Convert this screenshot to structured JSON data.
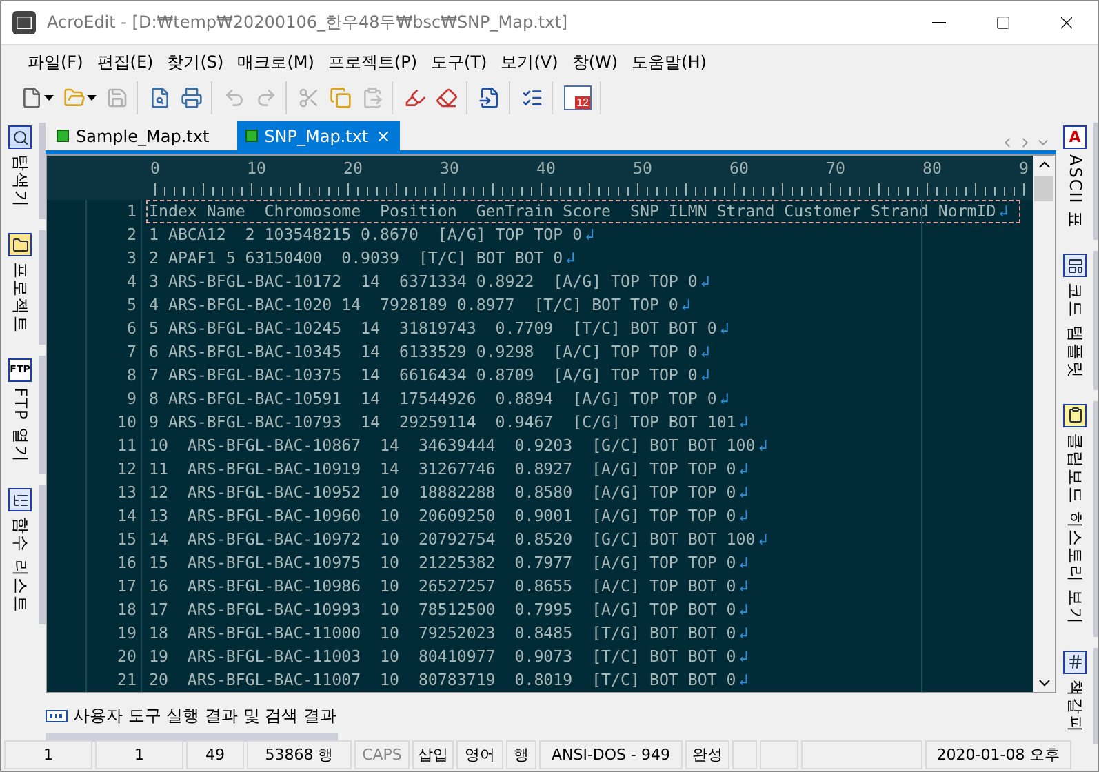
{
  "window": {
    "title": "AcroEdit - [D:₩temp₩20200106_한우48두₩bsc₩SNP_Map.txt]"
  },
  "menu": [
    "파일(F)",
    "편집(E)",
    "찾기(S)",
    "매크로(M)",
    "프로젝트(P)",
    "도구(T)",
    "보기(V)",
    "창(W)",
    "도움말(H)"
  ],
  "toolbar": [
    {
      "kind": "new",
      "disabled": false,
      "dropdown": true
    },
    {
      "kind": "open",
      "disabled": false,
      "dropdown": true
    },
    {
      "kind": "save",
      "disabled": true,
      "dropdown": false
    },
    {
      "kind": "preview",
      "disabled": false,
      "dropdown": false
    },
    {
      "kind": "print",
      "disabled": false,
      "dropdown": false
    },
    {
      "kind": "undo",
      "disabled": true,
      "dropdown": false
    },
    {
      "kind": "redo",
      "disabled": true,
      "dropdown": false
    },
    {
      "kind": "cut",
      "disabled": true,
      "dropdown": false
    },
    {
      "kind": "copy",
      "disabled": false,
      "dropdown": false
    },
    {
      "kind": "paste",
      "disabled": true,
      "dropdown": false
    },
    {
      "kind": "highlight",
      "disabled": false,
      "dropdown": false
    },
    {
      "kind": "erase",
      "disabled": false,
      "dropdown": false
    },
    {
      "kind": "insert",
      "disabled": false,
      "dropdown": false
    },
    {
      "kind": "list",
      "disabled": false,
      "dropdown": false
    },
    {
      "kind": "calendar",
      "disabled": false,
      "dropdown": false,
      "label": "12"
    }
  ],
  "left_dock": [
    {
      "kind": "search",
      "label": "탐색기"
    },
    {
      "kind": "folder",
      "label": "프로젝트"
    },
    {
      "kind": "ftp",
      "label": "FTP 열기",
      "icon_label": "FTP"
    },
    {
      "kind": "functions",
      "label": "함수 리스트"
    }
  ],
  "right_dock": [
    {
      "kind": "ascii",
      "label": "ASCII 표",
      "icon_label": "A"
    },
    {
      "kind": "template",
      "label": "코드 템플릿"
    },
    {
      "kind": "clipboard",
      "label": "클립보드 히스토리 보기"
    },
    {
      "kind": "bookmark",
      "label": "책갈피"
    }
  ],
  "tabs": [
    {
      "label": "Sample_Map.txt",
      "selected": false
    },
    {
      "label": "SNP_Map.txt",
      "selected": true
    }
  ],
  "ruler": [
    "0",
    "10",
    "20",
    "30",
    "40",
    "50",
    "60",
    "70",
    "80",
    "9"
  ],
  "lines": [
    {
      "number": "1",
      "text": "Index Name  Chromosome  Position  GenTrain Score  SNP ILMN Strand Customer Strand NormID",
      "eol": "↲",
      "current": true
    },
    {
      "number": "2",
      "text": "1 ABCA12  2 103548215 0.8670  [A/G] TOP TOP 0",
      "eol": "↲",
      "current": false
    },
    {
      "number": "3",
      "text": "2 APAF1 5 63150400  0.9039  [T/C] BOT BOT 0",
      "eol": "↲",
      "current": false
    },
    {
      "number": "4",
      "text": "3 ARS-BFGL-BAC-10172  14  6371334 0.8922  [A/G] TOP TOP 0",
      "eol": "↲",
      "current": false
    },
    {
      "number": "5",
      "text": "4 ARS-BFGL-BAC-1020 14  7928189 0.8977  [T/C] BOT TOP 0",
      "eol": "↲",
      "current": false
    },
    {
      "number": "6",
      "text": "5 ARS-BFGL-BAC-10245  14  31819743  0.7709  [T/C] BOT BOT 0",
      "eol": "↲",
      "current": false
    },
    {
      "number": "7",
      "text": "6 ARS-BFGL-BAC-10345  14  6133529 0.9298  [A/C] TOP TOP 0",
      "eol": "↲",
      "current": false
    },
    {
      "number": "8",
      "text": "7 ARS-BFGL-BAC-10375  14  6616434 0.8709  [A/G] TOP TOP 0",
      "eol": "↲",
      "current": false
    },
    {
      "number": "9",
      "text": "8 ARS-BFGL-BAC-10591  14  17544926  0.8894  [A/G] TOP TOP 0",
      "eol": "↲",
      "current": false
    },
    {
      "number": "10",
      "text": "9 ARS-BFGL-BAC-10793  14  29259114  0.9467  [C/G] TOP BOT 101",
      "eol": "↲",
      "current": false
    },
    {
      "number": "11",
      "text": "10  ARS-BFGL-BAC-10867  14  34639444  0.9203  [G/C] BOT BOT 100",
      "eol": "↲",
      "current": false
    },
    {
      "number": "12",
      "text": "11  ARS-BFGL-BAC-10919  14  31267746  0.8927  [A/G] TOP TOP 0",
      "eol": "↲",
      "current": false
    },
    {
      "number": "13",
      "text": "12  ARS-BFGL-BAC-10952  10  18882288  0.8580  [A/G] TOP TOP 0",
      "eol": "↲",
      "current": false
    },
    {
      "number": "14",
      "text": "13  ARS-BFGL-BAC-10960  10  20609250  0.9001  [A/G] TOP TOP 0",
      "eol": "↲",
      "current": false
    },
    {
      "number": "15",
      "text": "14  ARS-BFGL-BAC-10972  10  20792754  0.8520  [G/C] BOT BOT 100",
      "eol": "↲",
      "current": false
    },
    {
      "number": "16",
      "text": "15  ARS-BFGL-BAC-10975  10  21225382  0.7977  [A/G] TOP TOP 0",
      "eol": "↲",
      "current": false
    },
    {
      "number": "17",
      "text": "16  ARS-BFGL-BAC-10986  10  26527257  0.8655  [A/C] TOP BOT 0",
      "eol": "↲",
      "current": false
    },
    {
      "number": "18",
      "text": "17  ARS-BFGL-BAC-10993  10  78512500  0.7995  [A/G] TOP BOT 0",
      "eol": "↲",
      "current": false
    },
    {
      "number": "19",
      "text": "18  ARS-BFGL-BAC-11000  10  79252023  0.8485  [T/G] BOT BOT 0",
      "eol": "↲",
      "current": false
    },
    {
      "number": "20",
      "text": "19  ARS-BFGL-BAC-11003  10  80410977  0.9073  [T/C] BOT BOT 0",
      "eol": "↲",
      "current": false
    },
    {
      "number": "21",
      "text": "20  ARS-BFGL-BAC-11007  10  80783719  0.8019  [T/C] BOT BOT 0",
      "eol": "↲",
      "current": false
    }
  ],
  "output_panel": {
    "title": "사용자 도구 실행 결과 및 검색 결과"
  },
  "status_bar": [
    {
      "kind": "text",
      "text": "1",
      "disabled": false
    },
    {
      "kind": "text",
      "text": "1",
      "disabled": false
    },
    {
      "kind": "text",
      "text": "49",
      "disabled": false
    },
    {
      "kind": "text",
      "text": "53868 행",
      "disabled": false
    },
    {
      "kind": "text",
      "text": "CAPS",
      "disabled": true
    },
    {
      "kind": "text",
      "text": "삽입",
      "disabled": false
    },
    {
      "kind": "text",
      "text": "영어",
      "disabled": false
    },
    {
      "kind": "text",
      "text": "행",
      "disabled": false
    },
    {
      "kind": "text",
      "text": "ANSI-DOS - 949",
      "disabled": false
    },
    {
      "kind": "text",
      "text": "완성",
      "disabled": false
    },
    {
      "kind": "blank"
    },
    {
      "kind": "blank"
    },
    {
      "kind": "blank"
    },
    {
      "kind": "text",
      "text": "2020-01-08 오후",
      "disabled": false
    }
  ]
}
